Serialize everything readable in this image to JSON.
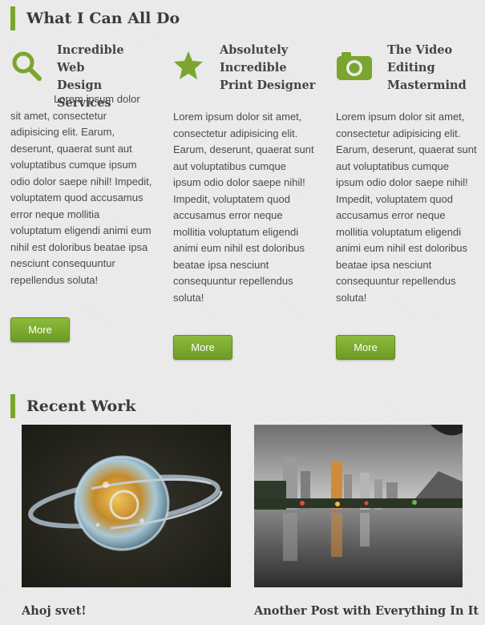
{
  "services_section": {
    "title": "What I Can All Do"
  },
  "services": [
    {
      "icon": "search-icon",
      "title": "Incredible Web\nDesign Services",
      "text": "Lorem ipsum dolor sit amet, consectetur adipisicing elit. Earum, deserunt, quaerat sunt aut voluptatibus cumque ipsum odio dolor saepe nihil! Impedit, voluptatem quod accusamus error neque mollitia voluptatum eligendi animi eum nihil est doloribus beatae ipsa nesciunt consequuntur repellendus soluta!",
      "button": "More"
    },
    {
      "icon": "star-icon",
      "title": "Absolutely\nIncredible\nPrint Designer",
      "text": "Lorem ipsum dolor sit amet, consectetur adipisicing elit. Earum, deserunt, quaerat sunt aut voluptatibus cumque ipsum odio dolor saepe nihil! Impedit, voluptatem quod accusamus error neque mollitia voluptatum eligendi animi eum nihil est doloribus beatae ipsa nesciunt consequuntur repellendus soluta!",
      "button": "More"
    },
    {
      "icon": "camera-icon",
      "title": "The Video\nEditing\nMastermind",
      "text": "Lorem ipsum dolor sit amet, consectetur adipisicing elit. Earum, deserunt, quaerat sunt aut voluptatibus cumque ipsum odio dolor saepe nihil! Impedit, voluptatem quod accusamus error neque mollitia voluptatum eligendi animi eum nihil est doloribus beatae ipsa nesciunt consequuntur repellendus soluta!",
      "button": "More"
    }
  ],
  "work_section": {
    "title": "Recent Work"
  },
  "works": [
    {
      "title": "Ahoj svet!",
      "thumb": "glass-orb-photo"
    },
    {
      "title": "Another Post with Everything In It",
      "thumb": "city-lake-photo"
    }
  ],
  "colors": {
    "accent": "#7ba52e",
    "button_top": "#8dbb3c",
    "button_bottom": "#6d9a24",
    "text": "#4a4a4a"
  }
}
